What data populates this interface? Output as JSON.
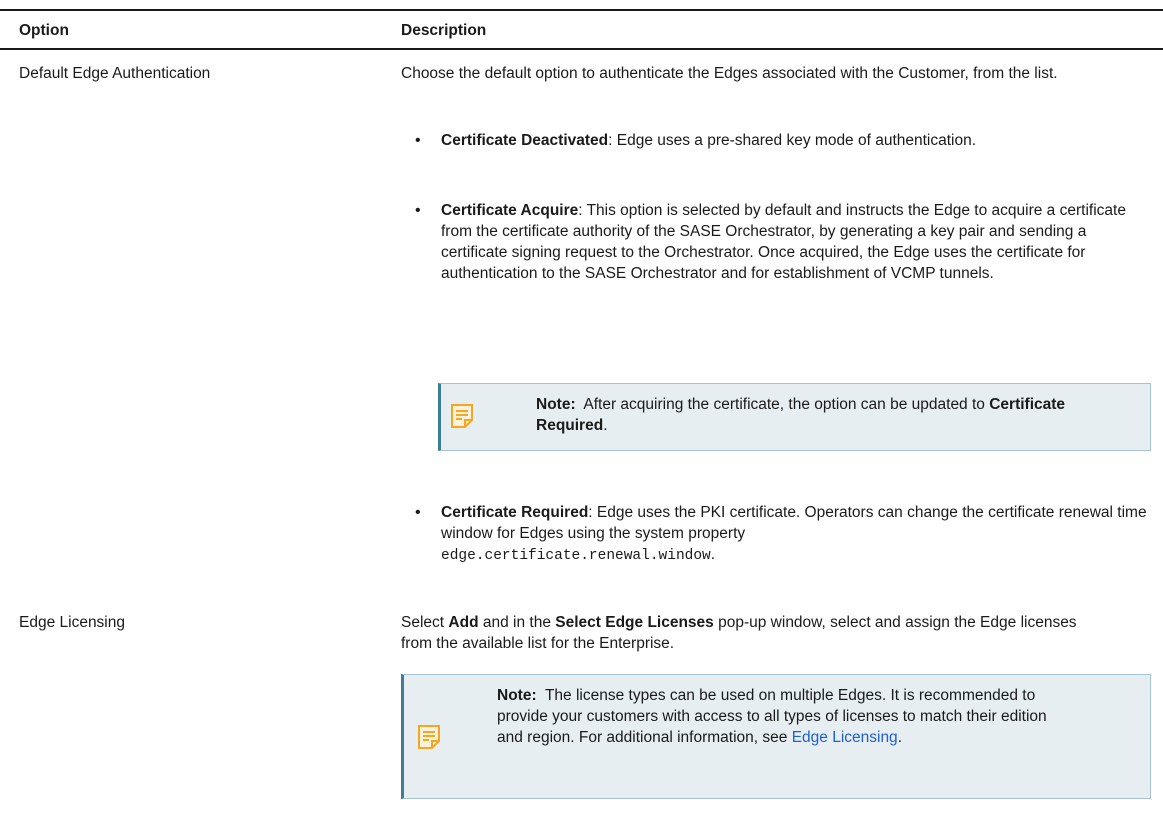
{
  "table": {
    "headers": {
      "option": "Option",
      "description": "Description"
    },
    "rows": [
      {
        "option": "Default Edge Authentication",
        "description": "Choose the default option to authenticate the Edges associated with the Customer, from the list.",
        "bullets": [
          {
            "term": "Certificate Deactivated",
            "text": ": Edge uses a pre-shared key mode of authentication."
          },
          {
            "term": "Certificate Acquire",
            "text": ": This option is selected by default and instructs the Edge to acquire a certificate from the certificate authority of the SASE Orchestrator, by generating a key pair and sending a certificate signing request to the Orchestrator. Once acquired, the Edge uses the certificate for authentication to the SASE Orchestrator and for establishment of VCMP tunnels."
          },
          {
            "term": "Certificate Required",
            "text": ": Edge uses the PKI certificate. Operators can change the certificate renewal time window for Edges using the system property",
            "code": "edge.certificate.renewal.window",
            "tail": "."
          }
        ],
        "note": {
          "label": "Note:",
          "text_before": "After acquiring the certificate, the option can be updated to",
          "bold": "Certificate Required",
          "text_after": "."
        }
      },
      {
        "option": "Edge Licensing",
        "description": {
          "p1": "Select",
          "b1": "Add",
          "p2": "and in the",
          "b2": "Select Edge Licenses",
          "p3": "pop-up window, select and assign the Edge licenses from the available list for the Enterprise."
        },
        "note": {
          "label": "Note:",
          "text": "The license types can be used on multiple Edges. It is recommended to provide your customers with access to all types of licenses to match their edition and region. For additional information, see",
          "link": "Edge Licensing",
          "tail": "."
        }
      }
    ]
  },
  "colors": {
    "link": "#1f5fcf",
    "note_bg": "#e6eef2",
    "note_border": "#3e7c98",
    "note_icon": "#f5a623"
  },
  "icons": {
    "note": "note-icon"
  }
}
